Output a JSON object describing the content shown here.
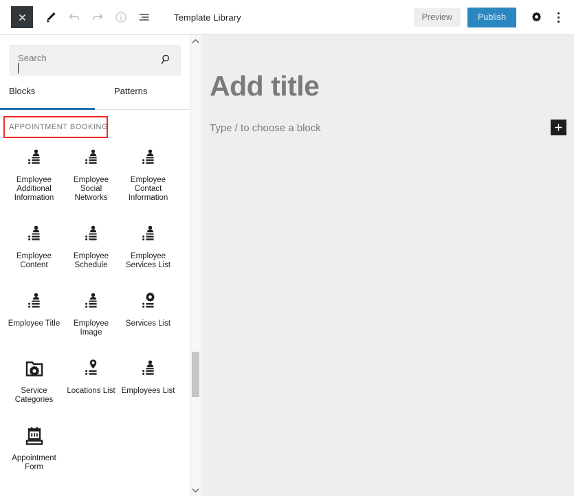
{
  "topbar": {
    "close_label": "Close",
    "close_icon": "close-icon",
    "edit_icon": "pencil-edit-icon",
    "undo_icon": "undo-icon",
    "redo_icon": "redo-icon",
    "info_icon": "info-icon",
    "list_view_icon": "list-view-icon",
    "title": "Template Library",
    "preview_label": "Preview",
    "publish_label": "Publish",
    "settings_icon": "gear-icon",
    "options_icon": "kebab-menu-icon"
  },
  "inserter": {
    "search": {
      "value": "",
      "placeholder": "Search",
      "icon": "search-icon"
    },
    "tabs": [
      {
        "label": "Blocks",
        "active": true
      },
      {
        "label": "Patterns",
        "active": false
      }
    ],
    "section_title": "APPOINTMENT BOOKING",
    "highlight_color": "#ee2b24",
    "accent_color": "#1d72aa",
    "blocks": [
      {
        "label": "Employee Additional Information",
        "icon": "person-list-icon"
      },
      {
        "label": "Employee Social Networks",
        "icon": "person-list-icon"
      },
      {
        "label": "Employee Contact Information",
        "icon": "person-list-icon"
      },
      {
        "label": "Employee Content",
        "icon": "person-list-icon"
      },
      {
        "label": "Employee Schedule",
        "icon": "person-list-icon"
      },
      {
        "label": "Employee Services List",
        "icon": "person-list-icon"
      },
      {
        "label": "Employee Title",
        "icon": "person-list-icon"
      },
      {
        "label": "Employee Image",
        "icon": "person-list-icon"
      },
      {
        "label": "Services List",
        "icon": "gear-list-icon"
      },
      {
        "label": "Service Categories",
        "icon": "folder-gear-icon"
      },
      {
        "label": "Locations List",
        "icon": "pin-list-icon"
      },
      {
        "label": "Employees List",
        "icon": "person-list-icon"
      },
      {
        "label": "Appointment Form",
        "icon": "calendar-icon"
      }
    ],
    "scrollbar": {
      "up_icon": "chevron-up-icon",
      "down_icon": "chevron-down-icon"
    }
  },
  "editor": {
    "title_placeholder": "Add title",
    "block_placeholder": "Type / to choose a block",
    "add_block_icon": "plus-icon"
  }
}
